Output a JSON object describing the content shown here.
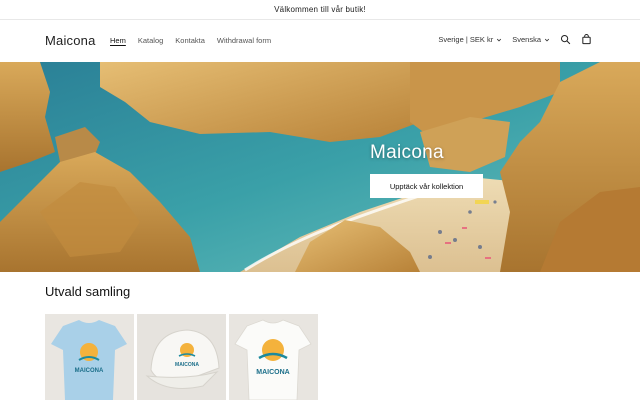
{
  "announcement": {
    "text": "Välkommen till vår butik!"
  },
  "header": {
    "logo": "Maicona",
    "nav": [
      {
        "label": "Hem",
        "active": true
      },
      {
        "label": "Katalog"
      },
      {
        "label": "Kontakta"
      },
      {
        "label": "Withdrawal form"
      }
    ],
    "country_selector": "Sverige | SEK kr",
    "language_selector": "Svenska",
    "icons": [
      "search-icon",
      "cart-icon",
      "chevron-down-icon"
    ]
  },
  "hero": {
    "title": "Maicona",
    "button_label": "Upptäck vår kollektion"
  },
  "featured": {
    "title": "Utvald samling",
    "products": [
      {
        "image": "light-blue t-shirt with logo",
        "logo_text": "MAICONA"
      },
      {
        "image": "white cap with logo",
        "logo_text": "MAICONA"
      },
      {
        "image": "white t-shirt with logo",
        "logo_text": "MAICONA"
      }
    ]
  },
  "colors": {
    "sea": "#2f8fa3",
    "rock": "#c99545",
    "sand": "#e8d3a8",
    "shirt_blue": "#a9d0e8",
    "accent_teal": "#1c8a9e"
  }
}
